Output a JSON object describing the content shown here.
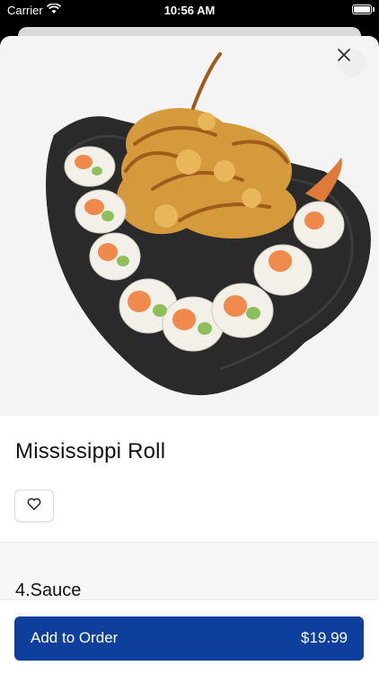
{
  "status_bar": {
    "carrier": "Carrier",
    "time": "10:56 AM"
  },
  "item": {
    "name": "Mississippi Roll"
  },
  "section": {
    "title": "4.Sauce"
  },
  "order": {
    "button_label": "Add to Order",
    "price": "$19.99"
  },
  "colors": {
    "primary": "#0f3f9c",
    "plate": "#2a2a2a"
  },
  "icons": {
    "close": "close-icon",
    "favorite": "heart-icon",
    "wifi": "wifi-icon",
    "battery": "battery-icon"
  }
}
